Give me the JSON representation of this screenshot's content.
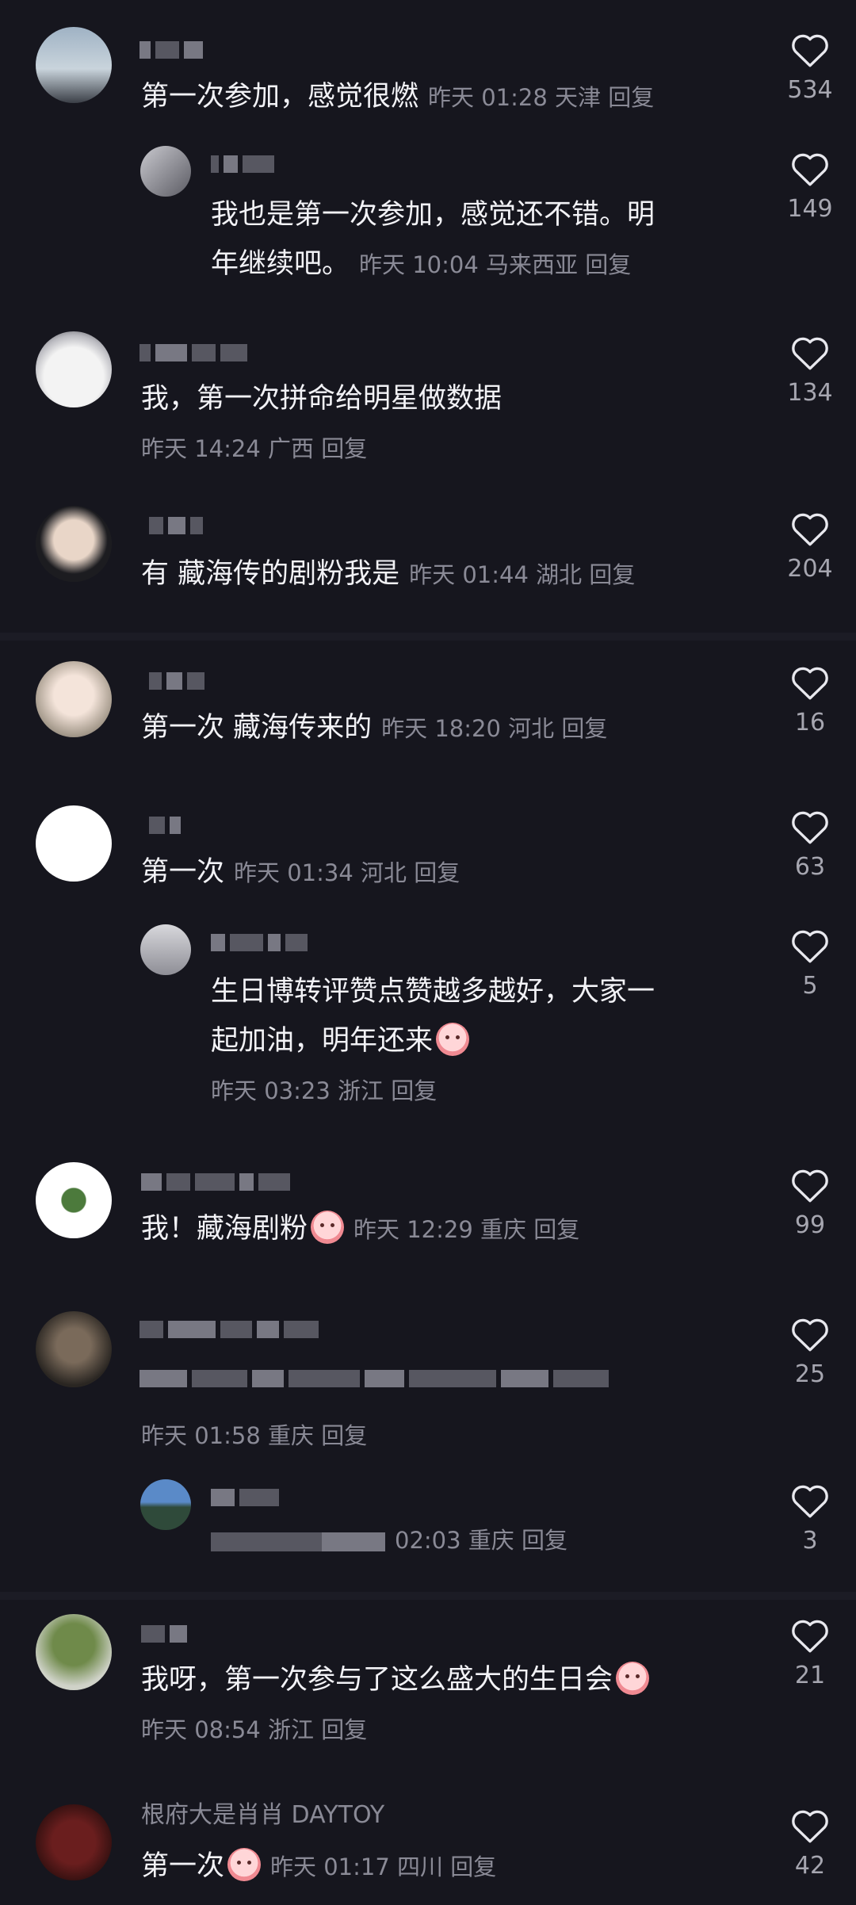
{
  "comments": [
    {
      "text": "第一次参加，感觉很燃",
      "time": "昨天 01:28",
      "loc": "天津",
      "reply": "回复",
      "likes": "534"
    },
    {
      "text": "我也是第一次参加，感觉还不错。明",
      "text2": "年继续吧。",
      "time": "昨天 10:04",
      "loc": "马来西亚",
      "reply": "回复",
      "likes": "149"
    },
    {
      "text": "我，第一次拼命给明星做数据",
      "time": "昨天 14:24",
      "loc": "广西",
      "reply": "回复",
      "likes": "134"
    },
    {
      "text": "有  藏海传的剧粉我是",
      "time": "昨天 01:44",
      "loc": "湖北",
      "reply": "回复",
      "likes": "204"
    },
    {
      "text": "第一次 藏海传来的",
      "time": "昨天 18:20",
      "loc": "河北",
      "reply": "回复",
      "likes": "16"
    },
    {
      "text": "第一次",
      "time": "昨天 01:34",
      "loc": "河北",
      "reply": "回复",
      "likes": "63"
    },
    {
      "text": "生日博转评赞点赞越多越好，大家一",
      "text2": "起加油，明年还来",
      "time": "昨天 03:23",
      "loc": "浙江",
      "reply": "回复",
      "likes": "5"
    },
    {
      "text": "我！藏海剧粉",
      "time": "昨天 12:29",
      "loc": "重庆",
      "reply": "回复",
      "likes": "99"
    },
    {
      "time": "昨天 01:58",
      "loc": "重庆",
      "reply": "回复",
      "likes": "25"
    },
    {
      "time": "02:03",
      "loc": "重庆",
      "reply": "回复",
      "likes": "3"
    },
    {
      "text": "我呀，第一次参与了这么盛大的生日会",
      "time": "昨天 08:54",
      "loc": "浙江",
      "reply": "回复",
      "likes": "21"
    },
    {
      "text": "第一次",
      "time": "昨天 01:17",
      "loc": "四川",
      "reply": "回复",
      "likes": "42",
      "uname": "根府大是肖肖 DAYTOY"
    }
  ],
  "colors": {
    "bg": "#16161e",
    "text": "#f2f2f6",
    "meta": "#8a8a96",
    "count": "#a6a6b0"
  },
  "icons": {
    "like": "heart-outline-icon"
  }
}
